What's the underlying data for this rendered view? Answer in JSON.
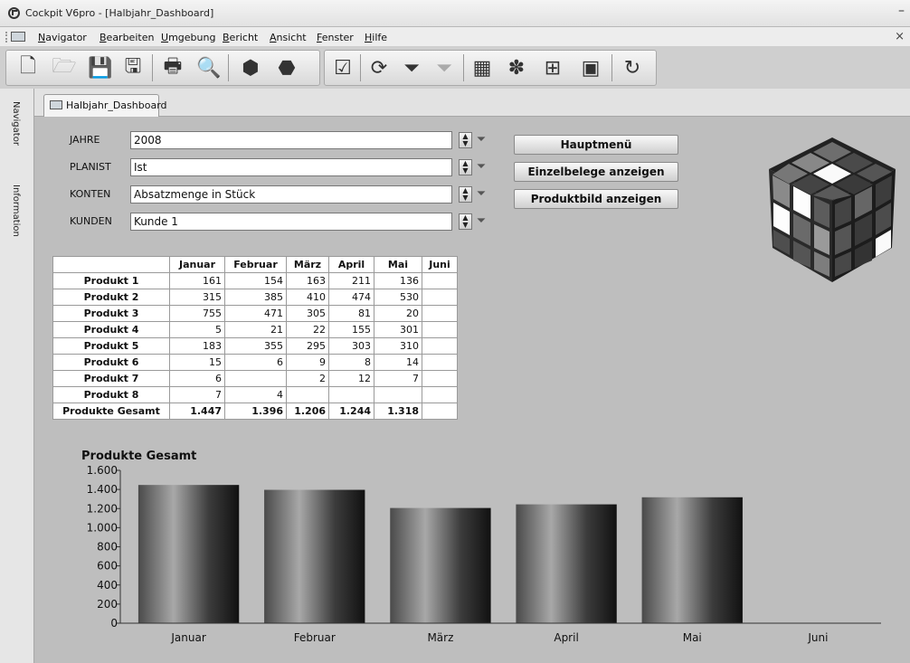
{
  "window": {
    "title": "Cockpit V6pro - [Halbjahr_Dashboard]",
    "minimize_glyph": "–",
    "close_glyph": "×"
  },
  "menubar": {
    "items": [
      {
        "label": "Navigator"
      },
      {
        "label": "Bearbeiten"
      },
      {
        "label": "Umgebung"
      },
      {
        "label": "Bericht"
      },
      {
        "label": "Ansicht"
      },
      {
        "label": "Fenster"
      },
      {
        "label": "Hilfe"
      }
    ]
  },
  "toolbar": {
    "icons": [
      "new-document-icon",
      "open-folder-icon",
      "save-icon",
      "save-all-icon",
      "print-icon",
      "print-preview-icon",
      "cube-icon",
      "cube-mail-icon",
      "checkbox-icon",
      "refresh-arrows-icon",
      "filter-icon",
      "filter-clear-icon",
      "grid-icon",
      "puzzle-icon",
      "tree-icon",
      "window-icon",
      "reload-icon"
    ],
    "glyphs": [
      "🗋",
      "🗁",
      "💾",
      "🖫",
      "🖶",
      "🔍",
      "⬢",
      "⬣",
      "☑",
      "⟳",
      "⏷",
      "⏷",
      "▦",
      "✽",
      "⊞",
      "▣",
      "↻"
    ]
  },
  "leftbar": {
    "navigator_label": "Navigator",
    "information_label": "Information"
  },
  "tab": {
    "label": "Halbjahr_Dashboard"
  },
  "fields": [
    {
      "label": "JAHRE",
      "value": "2008"
    },
    {
      "label": "PLANIST",
      "value": "Ist"
    },
    {
      "label": "KONTEN",
      "value": "Absatzmenge in Stück"
    },
    {
      "label": "KUNDEN",
      "value": "Kunde 1"
    }
  ],
  "buttons": {
    "hauptmenue": "Hauptmenü",
    "einzelbelege": "Einzelbelege anzeigen",
    "produktbild": "Produktbild anzeigen"
  },
  "table": {
    "columns": [
      "",
      "Januar",
      "Februar",
      "März",
      "April",
      "Mai",
      "Juni"
    ],
    "rows": [
      {
        "label": "Produkt 1",
        "values": [
          "161",
          "154",
          "163",
          "211",
          "136",
          ""
        ]
      },
      {
        "label": "Produkt 2",
        "values": [
          "315",
          "385",
          "410",
          "474",
          "530",
          ""
        ]
      },
      {
        "label": "Produkt 3",
        "values": [
          "755",
          "471",
          "305",
          "81",
          "20",
          ""
        ]
      },
      {
        "label": "Produkt 4",
        "values": [
          "5",
          "21",
          "22",
          "155",
          "301",
          ""
        ]
      },
      {
        "label": "Produkt 5",
        "values": [
          "183",
          "355",
          "295",
          "303",
          "310",
          ""
        ]
      },
      {
        "label": "Produkt 6",
        "values": [
          "15",
          "6",
          "9",
          "8",
          "14",
          ""
        ]
      },
      {
        "label": "Produkt 7",
        "values": [
          "6",
          "",
          "2",
          "12",
          "7",
          ""
        ]
      },
      {
        "label": "Produkt 8",
        "values": [
          "7",
          "4",
          "",
          "",
          "",
          ""
        ]
      }
    ],
    "total": {
      "label": "Produkte Gesamt",
      "values": [
        "1.447",
        "1.396",
        "1.206",
        "1.244",
        "1.318",
        ""
      ]
    }
  },
  "chart_data": {
    "type": "bar",
    "title": "Produkte Gesamt",
    "categories": [
      "Januar",
      "Februar",
      "März",
      "April",
      "Mai",
      "Juni"
    ],
    "values": [
      1447,
      1396,
      1206,
      1244,
      1318,
      0
    ],
    "ylim": [
      0,
      1600
    ],
    "yticks": [
      0,
      200,
      400,
      600,
      800,
      1000,
      1200,
      1400,
      1600
    ],
    "ytick_labels": [
      "0",
      "200",
      "400",
      "600",
      "800",
      "1.000",
      "1.200",
      "1.400",
      "1.600"
    ],
    "grid": false
  }
}
